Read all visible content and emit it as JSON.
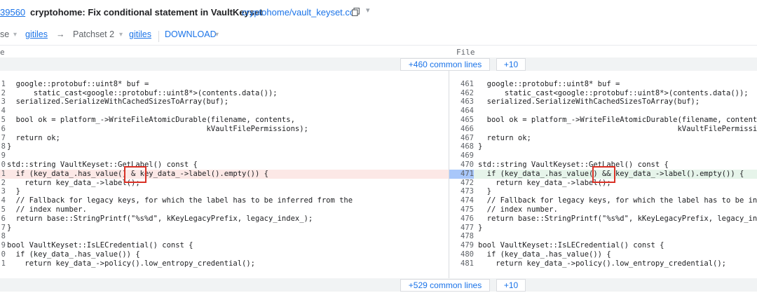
{
  "header": {
    "change_number": "39560",
    "subject": "cryptohome: Fix conditional statement in VaultKeyset",
    "file_path": "cryptohome/vault_keyset.cc",
    "copy_icon": "copy-icon",
    "menu_icon": "chevron-down-icon"
  },
  "patchset_bar": {
    "base_label": "se",
    "base_link": "gitiles",
    "arrow": "→",
    "patchset_label": "Patchset 2",
    "patch_link": "gitiles",
    "download_label": "DOWNLOAD"
  },
  "column_header": {
    "left_label": "e",
    "right_label": "File"
  },
  "context_top": {
    "expand_label": "+460 common lines",
    "more_label": "+10"
  },
  "context_bottom": {
    "expand_label": "+529 common lines",
    "more_label": "+10"
  },
  "left_lines": [
    {
      "num": "",
      "text": ""
    },
    {
      "num": "1",
      "text": "  google::protobuf::uint8* buf ="
    },
    {
      "num": "2",
      "text": "      static_cast<google::protobuf::uint8*>(contents.data());"
    },
    {
      "num": "3",
      "text": "  serialized.SerializeWithCachedSizesToArray(buf);"
    },
    {
      "num": "4",
      "text": ""
    },
    {
      "num": "5",
      "text": "  bool ok = platform_->WriteFileAtomicDurable(filename, contents,"
    },
    {
      "num": "6",
      "text": "                                             kVaultFilePermissions);"
    },
    {
      "num": "7",
      "text": "  return ok;"
    },
    {
      "num": "8",
      "text": "}"
    },
    {
      "num": "9",
      "text": ""
    },
    {
      "num": "0",
      "text": "std::string VaultKeyset::GetLabel() const {"
    },
    {
      "num": "1",
      "text": "  if (key_data_.has_value() & key_data_->label().empty()) {"
    },
    {
      "num": "2",
      "text": "    return key_data_->label();"
    },
    {
      "num": "3",
      "text": "  }"
    },
    {
      "num": "4",
      "text": "  // Fallback for legacy keys, for which the label has to be inferred from the"
    },
    {
      "num": "5",
      "text": "  // index number."
    },
    {
      "num": "6",
      "text": "  return base::StringPrintf(\"%s%d\", kKeyLegacyPrefix, legacy_index_);"
    },
    {
      "num": "7",
      "text": "}"
    },
    {
      "num": "8",
      "text": ""
    },
    {
      "num": "9",
      "text": "bool VaultKeyset::IsLECredential() const {"
    },
    {
      "num": "0",
      "text": "  if (key_data_.has_value()) {"
    },
    {
      "num": "1",
      "text": "    return key_data_->policy().low_entropy_credential();"
    }
  ],
  "right_lines": [
    {
      "num": "",
      "text": ""
    },
    {
      "num": "461",
      "text": "  google::protobuf::uint8* buf ="
    },
    {
      "num": "462",
      "text": "      static_cast<google::protobuf::uint8*>(contents.data());"
    },
    {
      "num": "463",
      "text": "  serialized.SerializeWithCachedSizesToArray(buf);"
    },
    {
      "num": "464",
      "text": ""
    },
    {
      "num": "465",
      "text": "  bool ok = platform_->WriteFileAtomicDurable(filename, contents,"
    },
    {
      "num": "466",
      "text": "                                             kVaultFilePermissions);"
    },
    {
      "num": "467",
      "text": "  return ok;"
    },
    {
      "num": "468",
      "text": "}"
    },
    {
      "num": "469",
      "text": ""
    },
    {
      "num": "470",
      "text": "std::string VaultKeyset::GetLabel() const {"
    },
    {
      "num": "471",
      "text": "  if (key_data_.has_value() && key_data_->label().empty()) {"
    },
    {
      "num": "472",
      "text": "    return key_data_->label();"
    },
    {
      "num": "473",
      "text": "  }"
    },
    {
      "num": "474",
      "text": "  // Fallback for legacy keys, for which the label has to be inferred from the"
    },
    {
      "num": "475",
      "text": "  // index number."
    },
    {
      "num": "476",
      "text": "  return base::StringPrintf(\"%s%d\", kKeyLegacyPrefix, legacy_index_);"
    },
    {
      "num": "477",
      "text": "}"
    },
    {
      "num": "478",
      "text": ""
    },
    {
      "num": "479",
      "text": "bool VaultKeyset::IsLECredential() const {"
    },
    {
      "num": "480",
      "text": "  if (key_data_.has_value()) {"
    },
    {
      "num": "481",
      "text": "    return key_data_->policy().low_entropy_credential();"
    }
  ],
  "highlight": {
    "removed_line_index": 11,
    "added_line_index": 11,
    "removed_color": "#fce8e6",
    "added_color": "#e6f4ea",
    "annotation_color": "#d93025"
  }
}
